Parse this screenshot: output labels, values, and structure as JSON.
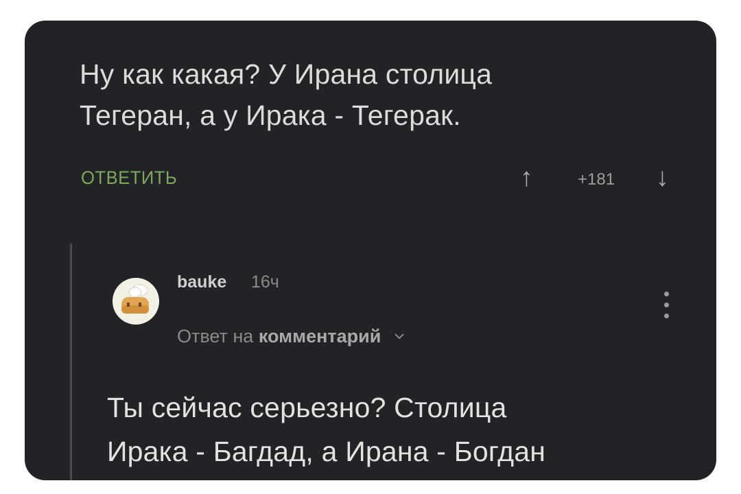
{
  "comment": {
    "text": "Ну как какая? У Ирана столица\nТегеран, а у Ирака - Тегерак.",
    "reply_label": "ОТВЕТИТЬ",
    "score": "+181",
    "upvote_icon": "↑",
    "downvote_icon": "↓"
  },
  "reply": {
    "username": "bauke",
    "time": "16ч",
    "context_prefix": "Ответ на",
    "context_target": "комментарий",
    "text": "Ты сейчас серьезно? Столица\nИрака - Багдад, а Ирана - Богдан"
  },
  "colors": {
    "card_background": "#222326",
    "accent_green": "#7ea85c",
    "text": "#dcdcdc",
    "muted": "#8a8a8a"
  },
  "icons": [
    "arrow-up-icon",
    "arrow-down-icon",
    "chevron-down-icon",
    "more-vertical-icon",
    "avatar-chef-icon"
  ]
}
